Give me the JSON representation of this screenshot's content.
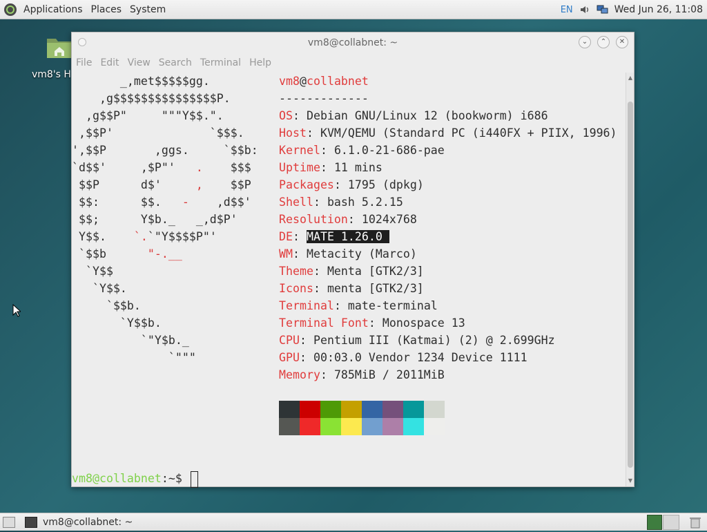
{
  "top_panel": {
    "menus": [
      "Applications",
      "Places",
      "System"
    ],
    "keyboard_layout": "EN",
    "clock": "Wed Jun 26, 11:08"
  },
  "desktop": {
    "home_icon_label": "vm8's H"
  },
  "terminal": {
    "title": "vm8@collabnet: ~",
    "menu": [
      "File",
      "Edit",
      "View",
      "Search",
      "Terminal",
      "Help"
    ],
    "header_user": "vm8",
    "header_at": "@",
    "header_host": "collabnet",
    "separator": "-------------",
    "info": [
      {
        "key": "OS",
        "value": "Debian GNU/Linux 12 (bookworm) i686"
      },
      {
        "key": "Host",
        "value": "KVM/QEMU (Standard PC (i440FX + PIIX, 1996)"
      },
      {
        "key": "Kernel",
        "value": "6.1.0-21-686-pae"
      },
      {
        "key": "Uptime",
        "value": "11 mins"
      },
      {
        "key": "Packages",
        "value": "1795 (dpkg)"
      },
      {
        "key": "Shell",
        "value": "bash 5.2.15"
      },
      {
        "key": "Resolution",
        "value": "1024x768"
      },
      {
        "key": "DE",
        "value": "MATE 1.26.0"
      },
      {
        "key": "WM",
        "value": "Metacity (Marco)"
      },
      {
        "key": "Theme",
        "value": "Menta [GTK2/3]"
      },
      {
        "key": "Icons",
        "value": "menta [GTK2/3]"
      },
      {
        "key": "Terminal",
        "value": "mate-terminal"
      },
      {
        "key": "Terminal Font",
        "value": "Monospace 13"
      },
      {
        "key": "CPU",
        "value": "Pentium III (Katmai) (2) @ 2.699GHz"
      },
      {
        "key": "GPU",
        "value": "00:03.0 Vendor 1234 Device 1111"
      },
      {
        "key": "Memory",
        "value": "785MiB / 2011MiB"
      }
    ],
    "palette_top": [
      "#2e3436",
      "#cc0000",
      "#4e9a06",
      "#c4a000",
      "#3465a4",
      "#75507b",
      "#06989a",
      "#d3d7cf"
    ],
    "palette_bottom": [
      "#555753",
      "#ef2929",
      "#8ae234",
      "#fce94f",
      "#729fcf",
      "#ad7fa8",
      "#34e2e2",
      "#eeeeec"
    ],
    "prompt_user": "vm8@collabnet",
    "prompt_rest": ":~$ "
  },
  "bottom_panel": {
    "task_label": "vm8@collabnet: ~"
  }
}
